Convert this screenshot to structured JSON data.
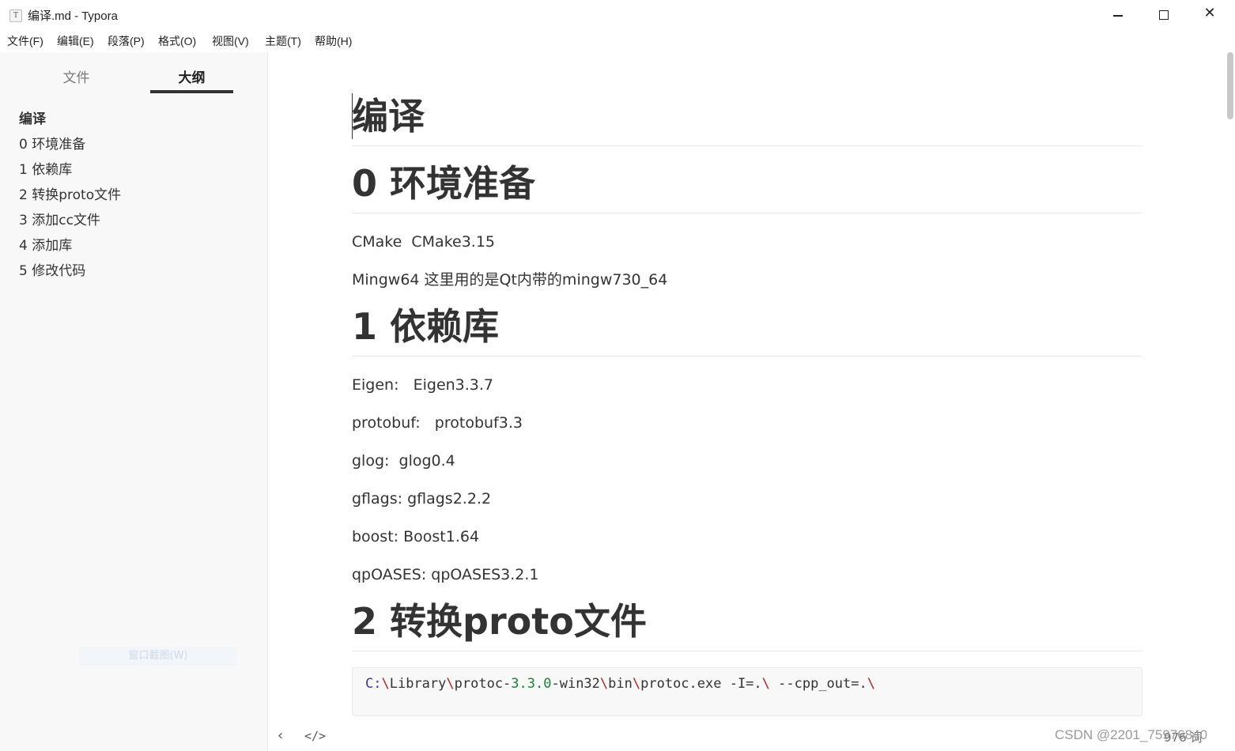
{
  "window": {
    "app_icon": "typora-icon",
    "title": "编译.md - Typora",
    "minimize_icon": "minimize-icon",
    "maximize_icon": "maximize-icon",
    "close_icon": "close-icon"
  },
  "menubar": {
    "items": [
      "文件(F)",
      "编辑(E)",
      "段落(P)",
      "格式(O)",
      "视图(V)",
      "主题(T)",
      "帮助(H)"
    ]
  },
  "sidebar": {
    "tabs": {
      "files": "文件",
      "outline": "大纲"
    },
    "active_tab": "outline",
    "outline": [
      "编译",
      "0 环境准备",
      "1 依赖库",
      "2 转换proto文件",
      "3 添加cc文件",
      "4 添加库",
      "5 修改代码"
    ],
    "ghost_hint": "窗口截图(W)"
  },
  "document": {
    "h1_title": "编译",
    "h1_env": "0 环境准备",
    "env_lines": [
      "CMake  CMake3.15",
      "Mingw64 这里用的是Qt内带的mingw730_64"
    ],
    "h1_deps": "1 依赖库",
    "dep_lines": [
      "Eigen:   Eigen3.3.7",
      "protobuf:   protobuf3.3",
      "glog:  glog0.4",
      "gflags: gflags2.2.2",
      "boost: Boost1.64",
      "qpOASES: qpOASES3.2.1"
    ],
    "h1_proto": "2 转换proto文件",
    "code": {
      "drive": "C:",
      "bs": "\\",
      "seg1": "Library",
      "seg2": "protoc-",
      "version": "3.3.0",
      "seg3": "-win32",
      "seg4": "bin",
      "seg5": "protoc.exe -I=.",
      "seg6": " --cpp_out=."
    }
  },
  "statusbar": {
    "back_icon": "chevron-left-icon",
    "source_icon": "source-code-icon",
    "word_count": "976 词"
  },
  "watermark": "CSDN @2201_75976840",
  "colors": {
    "sidebar_bg": "#f8f8f8",
    "text": "#333333",
    "code_bg": "#f8f8f8",
    "backslash": "#b22222",
    "number": "#1a7f37"
  }
}
